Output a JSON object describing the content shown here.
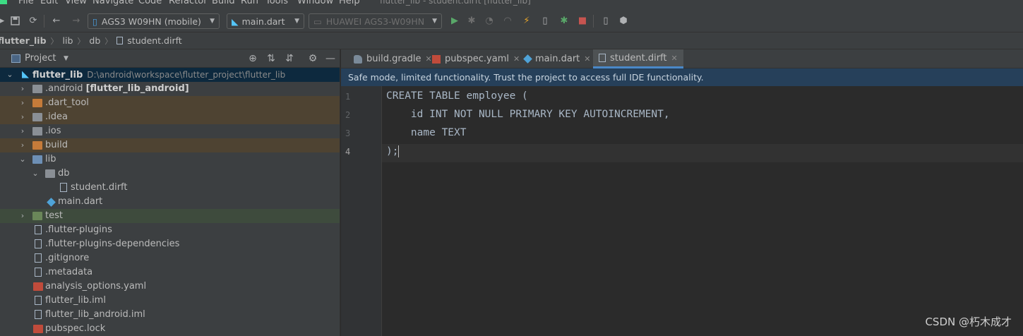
{
  "menubar": {
    "items": [
      "File",
      "Edit",
      "View",
      "Navigate",
      "Code",
      "Refactor",
      "Build",
      "Run",
      "Tools",
      "Window",
      "Help"
    ],
    "window_title": "flutter_lib - student.dirft [flutter_lib]"
  },
  "toolbar": {
    "device_combo": "AGS3 W09HN (mobile)",
    "run_config_combo": "main.dart",
    "target_device_combo": "HUAWEI AGS3-W09HN",
    "icons": [
      "save-all-icon",
      "sync-icon",
      "back-icon",
      "forward-icon",
      "run-icon",
      "debug-icon",
      "profile-icon",
      "attach-icon",
      "hot-reload-icon",
      "apply-changes-icon",
      "flutter-inspector-icon",
      "stop-icon",
      "device-manager-icon",
      "sdk-manager-icon"
    ],
    "colors": {
      "run": "#59a869",
      "stop": "#c75450",
      "hot_reload": "#e8a52a"
    }
  },
  "breadcrumb": [
    "flutter_lib",
    "lib",
    "db",
    "student.dirft"
  ],
  "project_pane": {
    "title": "Project",
    "tree": [
      {
        "label": "flutter_lib",
        "path": "D:\\android\\workspace\\flutter_project\\flutter_lib",
        "icon": "flutter-icon",
        "expanded": true,
        "selected": true
      },
      {
        "label": ".android",
        "suffix": "[flutter_lib_android]",
        "icon": "folder-icon"
      },
      {
        "label": ".dart_tool",
        "icon": "folder-icon",
        "excluded": true
      },
      {
        "label": ".idea",
        "icon": "folder-icon",
        "excluded": true
      },
      {
        "label": ".ios",
        "icon": "folder-icon"
      },
      {
        "label": "build",
        "icon": "folder-icon",
        "excluded": true
      },
      {
        "label": "lib",
        "icon": "folder-icon",
        "expanded": true
      },
      {
        "label": "db",
        "icon": "folder-icon",
        "expanded": true
      },
      {
        "label": "student.dirft",
        "icon": "file-icon"
      },
      {
        "label": "main.dart",
        "icon": "dart-icon"
      },
      {
        "label": "test",
        "icon": "folder-icon",
        "test": true
      },
      {
        "label": ".flutter-plugins",
        "icon": "file-icon"
      },
      {
        "label": ".flutter-plugins-dependencies",
        "icon": "file-icon"
      },
      {
        "label": ".gitignore",
        "icon": "file-icon"
      },
      {
        "label": ".metadata",
        "icon": "file-icon"
      },
      {
        "label": "analysis_options.yaml",
        "icon": "yaml-icon"
      },
      {
        "label": "flutter_lib.iml",
        "icon": "file-icon"
      },
      {
        "label": "flutter_lib_android.iml",
        "icon": "file-icon"
      },
      {
        "label": "pubspec.lock",
        "icon": "yaml-icon"
      }
    ]
  },
  "editor": {
    "tabs": [
      {
        "label": "build.gradle",
        "icon": "gradle-icon"
      },
      {
        "label": "pubspec.yaml",
        "icon": "yaml-icon"
      },
      {
        "label": "main.dart",
        "icon": "dart-icon"
      },
      {
        "label": "student.dirft",
        "icon": "file-icon",
        "active": true
      }
    ],
    "banner": "Safe mode, limited functionality. Trust the project to access full IDE functionality.",
    "line_numbers": [
      "1",
      "2",
      "3",
      "4"
    ],
    "code_lines": [
      "CREATE TABLE employee (",
      "    id INT NOT NULL PRIMARY KEY AUTOINCREMENT,",
      "    name TEXT",
      ");"
    ],
    "current_line": 4
  },
  "watermark": "CSDN @朽木成才"
}
